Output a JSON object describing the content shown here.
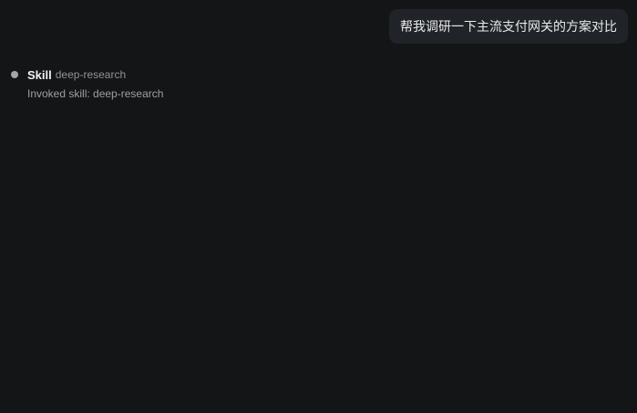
{
  "conversation": {
    "user_message": "帮我调研一下主流支付网关的方案对比",
    "event": {
      "title": "Skill",
      "skill_name": "deep-research",
      "detail": "Invoked skill: deep-research"
    }
  },
  "colors": {
    "background": "#131517",
    "bubble": "#202327",
    "bullet": "#a3a6ab"
  }
}
